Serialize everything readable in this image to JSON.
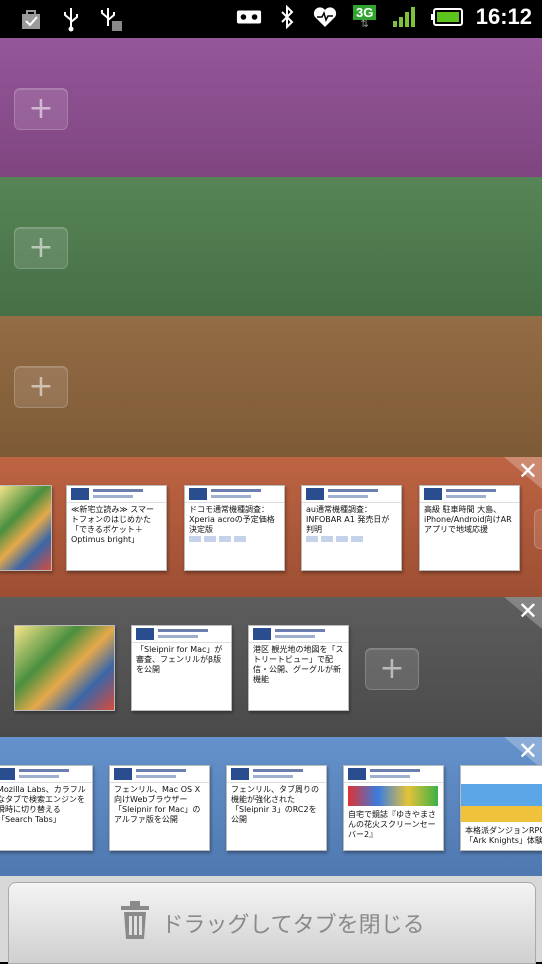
{
  "status_bar": {
    "time": "16:12",
    "network_type": "3G",
    "left_icons": [
      "shopping-bag-icon",
      "usb-icon",
      "usb-debug-icon"
    ],
    "right_icons": [
      "voicemail-icon",
      "bluetooth-icon",
      "heart-monitor-icon",
      "3g-icon",
      "signal-icon",
      "battery-icon"
    ]
  },
  "groups": [
    {
      "color": "#8b4f8e",
      "add_label": "+"
    },
    {
      "color": "#4f7a4e",
      "add_label": "+"
    },
    {
      "color": "#8a6540",
      "add_label": "+"
    },
    {
      "color": "#b05a3c",
      "close_label": "✕",
      "tabs": [
        {
          "title": ""
        },
        {
          "title": "≪新宅立読み≫ スマートフォンのはじめかた「できるポケット＋ Optimus bright」"
        },
        {
          "title": "ドコモ通常機種調査：Xperia acroの予定価格決定版"
        },
        {
          "title": "au通常機種調査：INFOBAR A1 発売日が判明"
        },
        {
          "title": "高級 駐車時間 大島、iPhone/Android向けARアプリで地域応援"
        }
      ]
    },
    {
      "color": "#555555",
      "close_label": "✕",
      "add_label": "+",
      "tabs": [
        {
          "title": ""
        },
        {
          "title": "「Sleipnir for Mac」が審査、フェンリルがβ版を公開"
        },
        {
          "title": "港区 観光地の地図を「ストリートビュー」で配信・公開、グーグルが新機能"
        }
      ]
    },
    {
      "color": "#5a85bf",
      "close_label": "✕",
      "tabs": [
        {
          "title": "Mozilla Labs、カラフルなタブで検索エンジンを瞬時に切り替える「Search Tabs」"
        },
        {
          "title": "フェンリル、Mac OS X向けWebブラウザー「Sleipnir for Mac」のアルファ版を公開"
        },
        {
          "title": "フェンリル、タブ周りの機能が強化された「Sleipnir 3」のRC2を公開"
        },
        {
          "title": "自宅で鏡誌『ゆきやまさんの花火スクリーンセーバー2』"
        },
        {
          "title": "本格派ダンジョンRPG「Ark Knights」体験版"
        }
      ]
    }
  ],
  "bottom": {
    "delete_label": "ドラッグしてタブを閉じる"
  }
}
